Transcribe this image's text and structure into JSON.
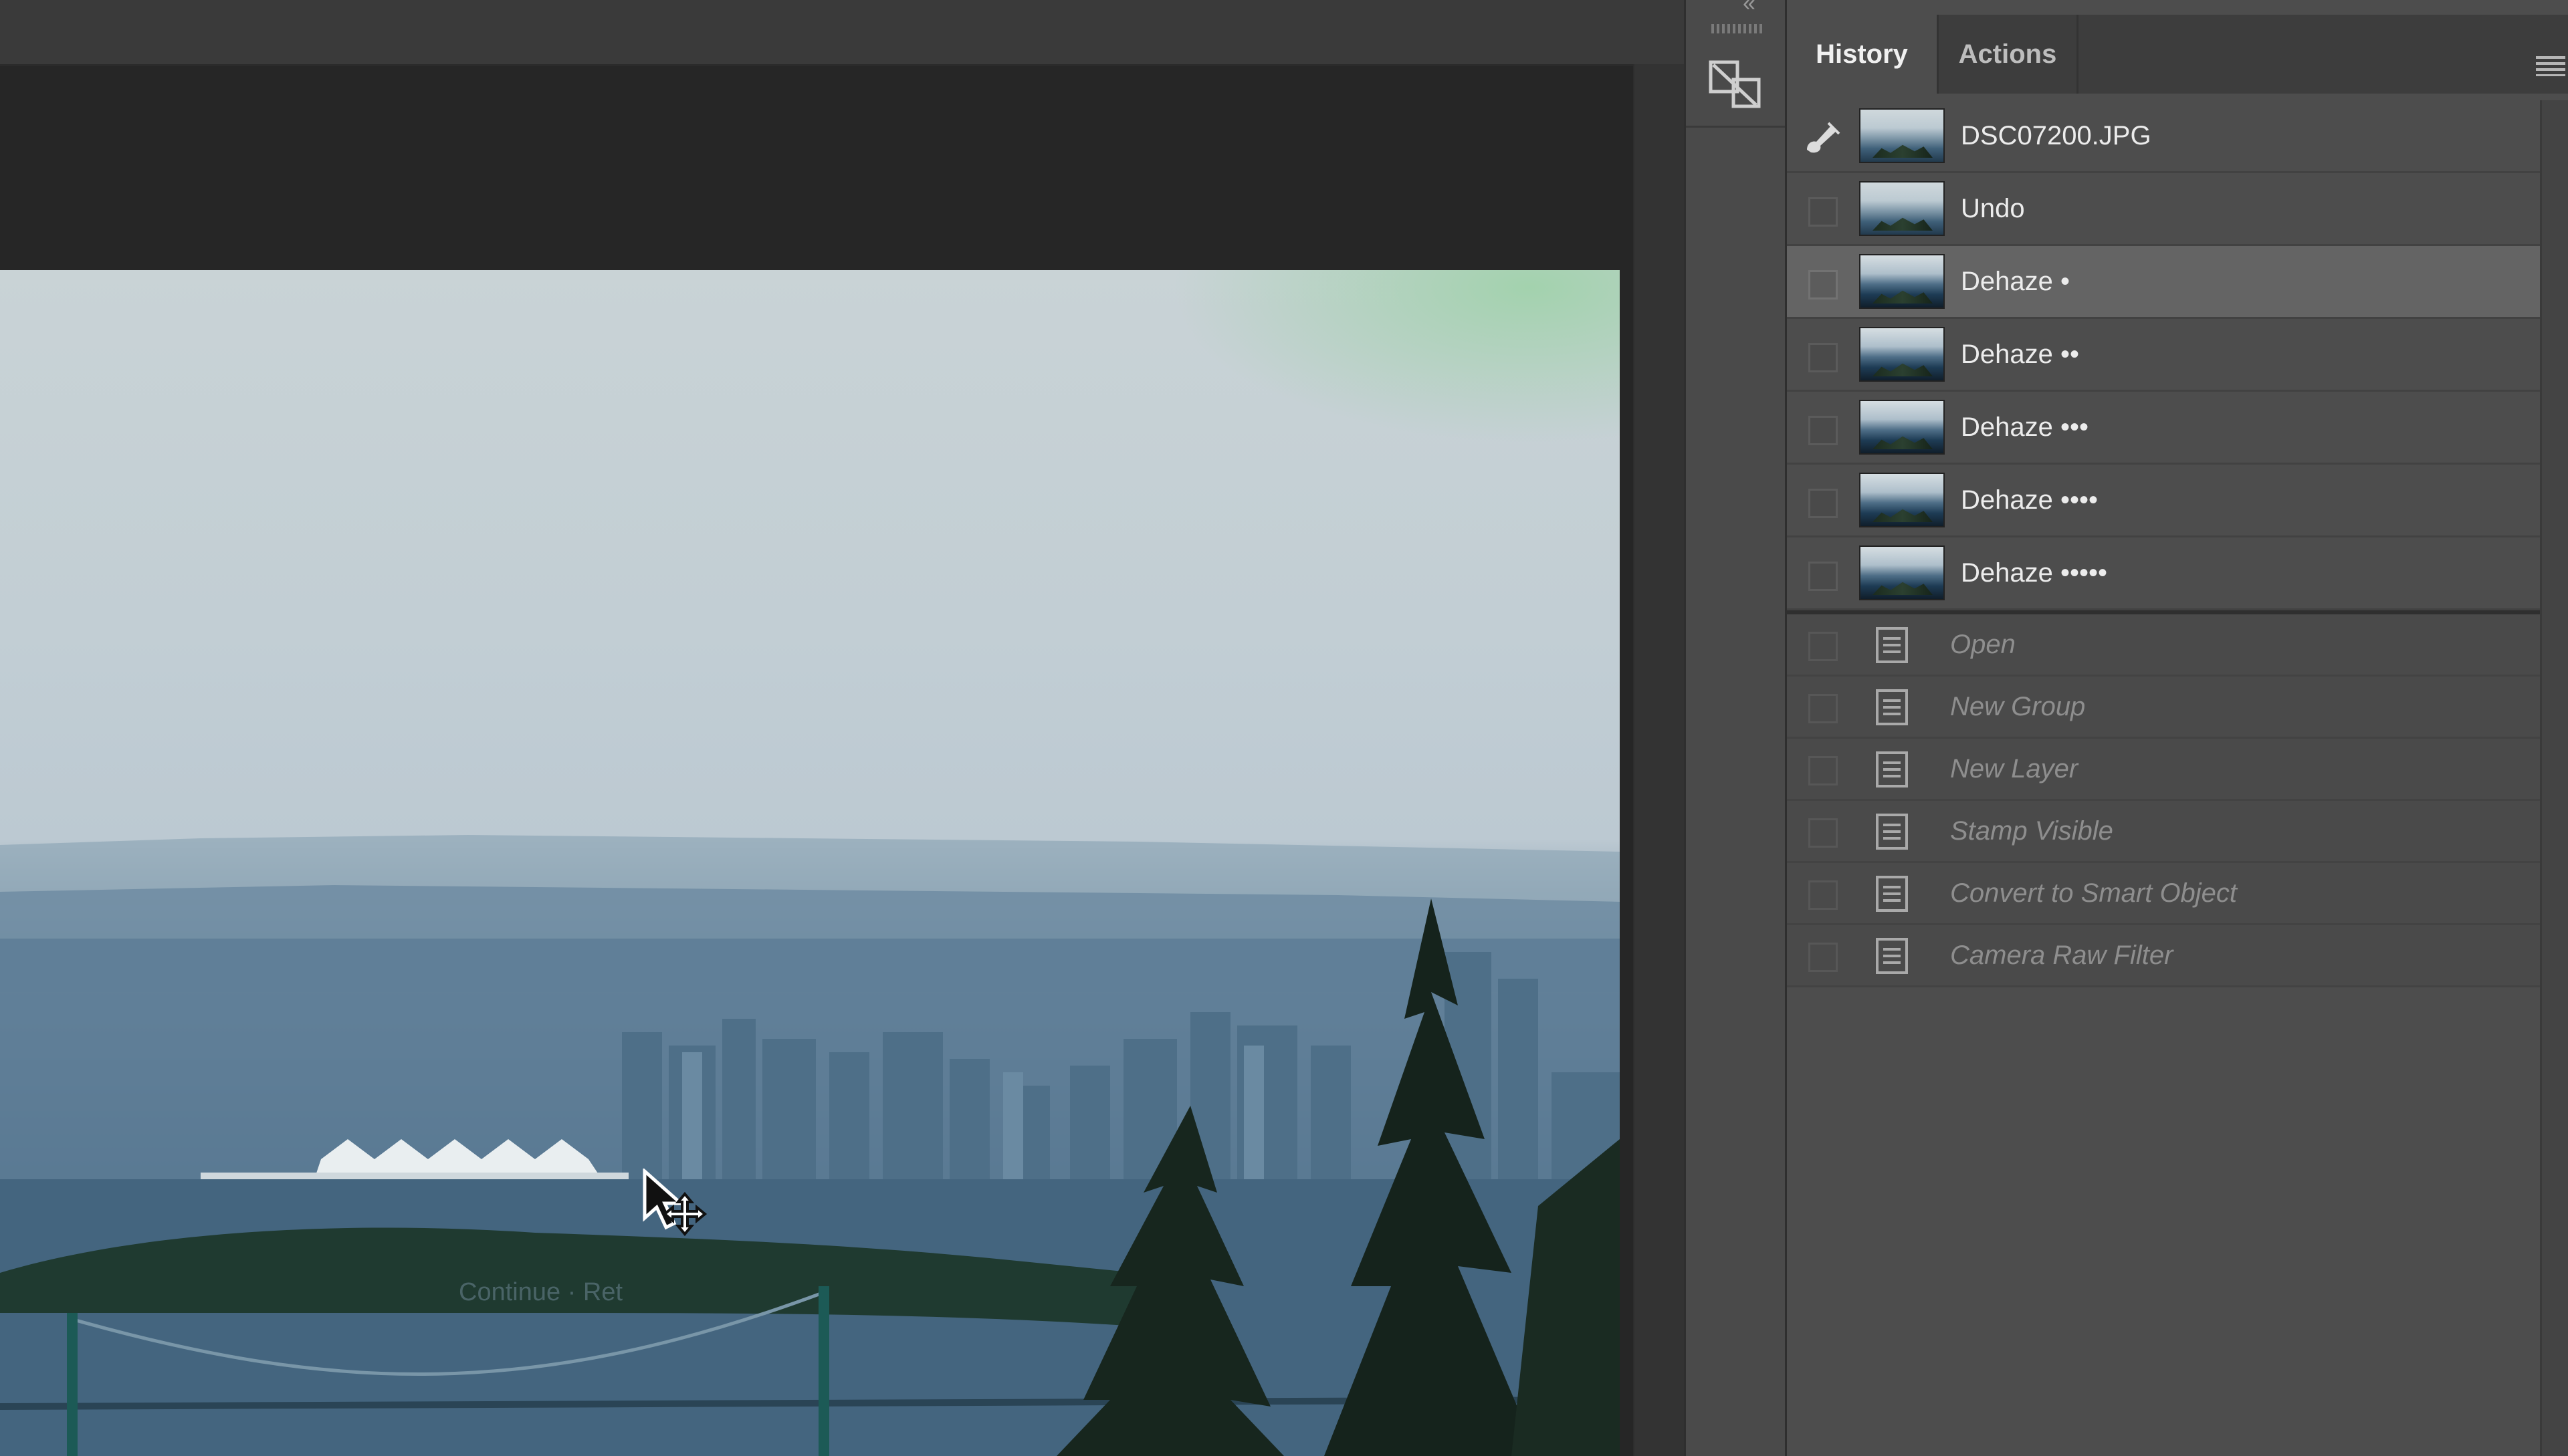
{
  "panel": {
    "tabs": [
      {
        "label": "History",
        "active": true
      },
      {
        "label": "Actions",
        "active": false
      }
    ]
  },
  "history": {
    "snapshot": {
      "label": "DSC07200.JPG",
      "icon": "history-brush-icon"
    },
    "states": [
      {
        "label": "Undo",
        "selected": false
      },
      {
        "label": "Dehaze •",
        "selected": true
      },
      {
        "label": "Dehaze ••",
        "selected": false
      },
      {
        "label": "Dehaze •••",
        "selected": false
      },
      {
        "label": "Dehaze ••••",
        "selected": false
      },
      {
        "label": "Dehaze •••••",
        "selected": false
      }
    ],
    "undone_states": [
      {
        "label": "Open",
        "icon": "document-icon"
      },
      {
        "label": "New Group",
        "icon": "document-icon"
      },
      {
        "label": "New Layer",
        "icon": "document-icon"
      },
      {
        "label": "Stamp Visible",
        "icon": "document-icon"
      },
      {
        "label": "Convert to Smart Object",
        "icon": "document-icon"
      },
      {
        "label": "Camera Raw Filter",
        "icon": "document-icon"
      }
    ]
  },
  "canvas": {
    "ghost_text": "Continue · Ret",
    "cursor": "move-cursor-icon"
  },
  "colors": {
    "panel_bg": "#4d4d4d",
    "selected_row": "#646464",
    "tab_bar": "#3d3d3d",
    "doc_bg": "#262626"
  }
}
